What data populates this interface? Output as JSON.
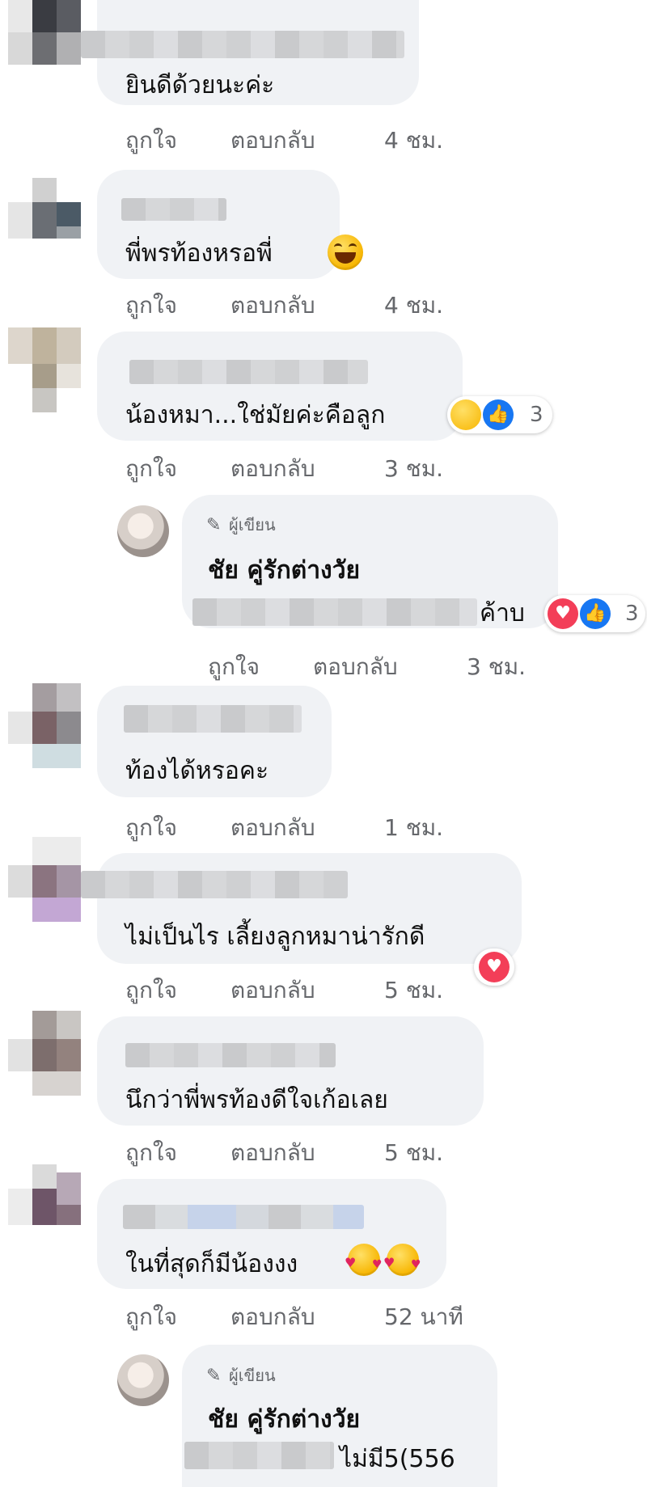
{
  "actions": {
    "like": "ถูกใจ",
    "reply": "ตอบกลับ"
  },
  "comments": [
    {
      "text": "ยินดีด้วยนะค่ะ",
      "time": "4 ชม."
    },
    {
      "text": "พี่พรท้องหรอพี่",
      "time": "4 ชม.",
      "emoji": "laughing-face"
    },
    {
      "text": "น้องหมา...ใช่มัยค่ะคือลูก",
      "time": "3 ชม.",
      "reactions": [
        "haha",
        "like"
      ],
      "reaction_count": "3"
    },
    {
      "text": "ท้องได้หรอคะ",
      "time": "1 ชม."
    },
    {
      "text": "ไม่เป็นไร เลี้ยงลูกหมาน่ารักดี",
      "time": "5 ชม.",
      "reactions": [
        "love"
      ]
    },
    {
      "text": "นึกว่าพี่พรท้องดีใจเก้อเลย",
      "time": "5 ชม."
    },
    {
      "text": "ในที่สุดก็มีน้องงง",
      "time": "52 นาที",
      "emoji": "smiling-face-with-hearts"
    }
  ],
  "replies": [
    {
      "badge": "ผู้เขียน",
      "author": "ชัย คู่รักต่างวัย",
      "text_tail": "ค้าบ",
      "time": "3 ชม.",
      "reactions": [
        "love",
        "like"
      ],
      "reaction_count": "3"
    },
    {
      "badge": "ผู้เขียน",
      "author": "ชัย คู่รักต่างวัย",
      "text_tail": "ไม่มี5(556"
    }
  ],
  "colors": {
    "bubble": "#f0f2f5",
    "meta": "#65676b",
    "like": "#1877f2",
    "love": "#f33e58",
    "haha": "#f7b500"
  }
}
